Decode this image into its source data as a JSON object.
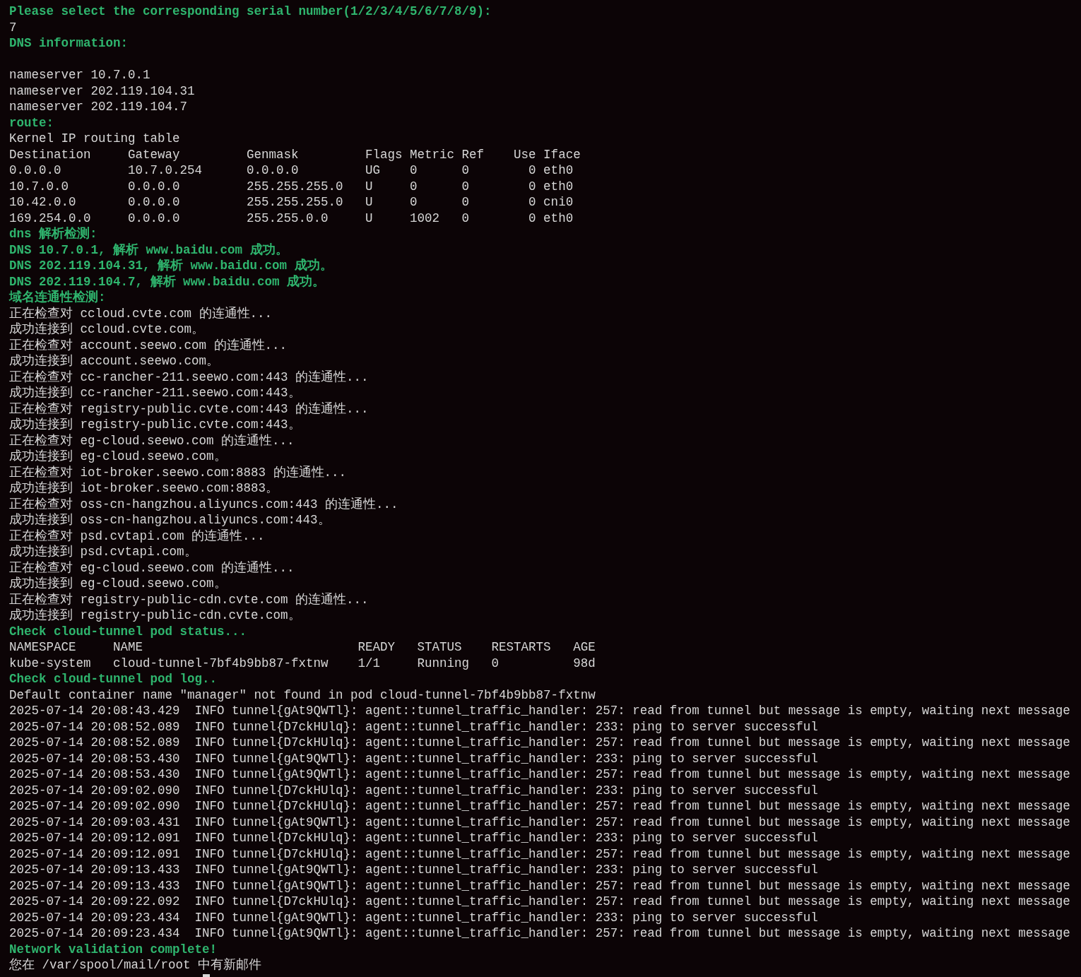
{
  "terminal": {
    "lines": [
      {
        "kind": "heading",
        "text": "Please select the corresponding serial number(1/2/3/4/5/6/7/8/9):"
      },
      {
        "kind": "plain",
        "text": "7"
      },
      {
        "kind": "heading",
        "text": "DNS information:"
      },
      {
        "kind": "blank"
      },
      {
        "kind": "plain",
        "text": "nameserver 10.7.0.1"
      },
      {
        "kind": "plain",
        "text": "nameserver 202.119.104.31"
      },
      {
        "kind": "plain",
        "text": "nameserver 202.119.104.7"
      },
      {
        "kind": "heading",
        "text": "route:"
      },
      {
        "kind": "plain",
        "text": "Kernel IP routing table"
      },
      {
        "kind": "plain",
        "text": "Destination     Gateway         Genmask         Flags Metric Ref    Use Iface"
      },
      {
        "kind": "plain",
        "text": "0.0.0.0         10.7.0.254      0.0.0.0         UG    0      0        0 eth0"
      },
      {
        "kind": "plain",
        "text": "10.7.0.0        0.0.0.0         255.255.255.0   U     0      0        0 eth0"
      },
      {
        "kind": "plain",
        "text": "10.42.0.0       0.0.0.0         255.255.255.0   U     0      0        0 cni0"
      },
      {
        "kind": "plain",
        "text": "169.254.0.0     0.0.0.0         255.255.0.0     U     1002   0        0 eth0"
      },
      {
        "kind": "heading",
        "text": "dns 解析检测:"
      },
      {
        "kind": "heading",
        "text": "DNS 10.7.0.1, 解析 www.baidu.com 成功。"
      },
      {
        "kind": "heading",
        "text": "DNS 202.119.104.31, 解析 www.baidu.com 成功。"
      },
      {
        "kind": "heading",
        "text": "DNS 202.119.104.7, 解析 www.baidu.com 成功。"
      },
      {
        "kind": "heading",
        "text": "域名连通性检测:"
      },
      {
        "kind": "plain",
        "text": "正在检查对 ccloud.cvte.com 的连通性..."
      },
      {
        "kind": "plain",
        "text": "成功连接到 ccloud.cvte.com。"
      },
      {
        "kind": "plain",
        "text": "正在检查对 account.seewo.com 的连通性..."
      },
      {
        "kind": "plain",
        "text": "成功连接到 account.seewo.com。"
      },
      {
        "kind": "plain",
        "text": "正在检查对 cc-rancher-211.seewo.com:443 的连通性..."
      },
      {
        "kind": "plain",
        "text": "成功连接到 cc-rancher-211.seewo.com:443。"
      },
      {
        "kind": "plain",
        "text": "正在检查对 registry-public.cvte.com:443 的连通性..."
      },
      {
        "kind": "plain",
        "text": "成功连接到 registry-public.cvte.com:443。"
      },
      {
        "kind": "plain",
        "text": "正在检查对 eg-cloud.seewo.com 的连通性..."
      },
      {
        "kind": "plain",
        "text": "成功连接到 eg-cloud.seewo.com。"
      },
      {
        "kind": "plain",
        "text": "正在检查对 iot-broker.seewo.com:8883 的连通性..."
      },
      {
        "kind": "plain",
        "text": "成功连接到 iot-broker.seewo.com:8883。"
      },
      {
        "kind": "plain",
        "text": "正在检查对 oss-cn-hangzhou.aliyuncs.com:443 的连通性..."
      },
      {
        "kind": "plain",
        "text": "成功连接到 oss-cn-hangzhou.aliyuncs.com:443。"
      },
      {
        "kind": "plain",
        "text": "正在检查对 psd.cvtapi.com 的连通性..."
      },
      {
        "kind": "plain",
        "text": "成功连接到 psd.cvtapi.com。"
      },
      {
        "kind": "plain",
        "text": "正在检查对 eg-cloud.seewo.com 的连通性..."
      },
      {
        "kind": "plain",
        "text": "成功连接到 eg-cloud.seewo.com。"
      },
      {
        "kind": "plain",
        "text": "正在检查对 registry-public-cdn.cvte.com 的连通性..."
      },
      {
        "kind": "plain",
        "text": "成功连接到 registry-public-cdn.cvte.com。"
      },
      {
        "kind": "heading",
        "text": "Check cloud-tunnel pod status..."
      },
      {
        "kind": "plain",
        "text": "NAMESPACE     NAME                             READY   STATUS    RESTARTS   AGE"
      },
      {
        "kind": "plain",
        "text": "kube-system   cloud-tunnel-7bf4b9bb87-fxtnw    1/1     Running   0          98d"
      },
      {
        "kind": "heading",
        "text": "Check cloud-tunnel pod log.."
      },
      {
        "kind": "plain",
        "text": "Default container name \"manager\" not found in pod cloud-tunnel-7bf4b9bb87-fxtnw"
      },
      {
        "kind": "plain",
        "text": "2025-07-14 20:08:43.429  INFO tunnel{gAt9QWTl}: agent::tunnel_traffic_handler: 257: read from tunnel but message is empty, waiting next message"
      },
      {
        "kind": "plain",
        "text": "2025-07-14 20:08:52.089  INFO tunnel{D7ckHUlq}: agent::tunnel_traffic_handler: 233: ping to server successful"
      },
      {
        "kind": "plain",
        "text": "2025-07-14 20:08:52.089  INFO tunnel{D7ckHUlq}: agent::tunnel_traffic_handler: 257: read from tunnel but message is empty, waiting next message"
      },
      {
        "kind": "plain",
        "text": "2025-07-14 20:08:53.430  INFO tunnel{gAt9QWTl}: agent::tunnel_traffic_handler: 233: ping to server successful"
      },
      {
        "kind": "plain",
        "text": "2025-07-14 20:08:53.430  INFO tunnel{gAt9QWTl}: agent::tunnel_traffic_handler: 257: read from tunnel but message is empty, waiting next message"
      },
      {
        "kind": "plain",
        "text": "2025-07-14 20:09:02.090  INFO tunnel{D7ckHUlq}: agent::tunnel_traffic_handler: 233: ping to server successful"
      },
      {
        "kind": "plain",
        "text": "2025-07-14 20:09:02.090  INFO tunnel{D7ckHUlq}: agent::tunnel_traffic_handler: 257: read from tunnel but message is empty, waiting next message"
      },
      {
        "kind": "plain",
        "text": "2025-07-14 20:09:03.431  INFO tunnel{gAt9QWTl}: agent::tunnel_traffic_handler: 257: read from tunnel but message is empty, waiting next message"
      },
      {
        "kind": "plain",
        "text": "2025-07-14 20:09:12.091  INFO tunnel{D7ckHUlq}: agent::tunnel_traffic_handler: 233: ping to server successful"
      },
      {
        "kind": "plain",
        "text": "2025-07-14 20:09:12.091  INFO tunnel{D7ckHUlq}: agent::tunnel_traffic_handler: 257: read from tunnel but message is empty, waiting next message"
      },
      {
        "kind": "plain",
        "text": "2025-07-14 20:09:13.433  INFO tunnel{gAt9QWTl}: agent::tunnel_traffic_handler: 233: ping to server successful"
      },
      {
        "kind": "plain",
        "text": "2025-07-14 20:09:13.433  INFO tunnel{gAt9QWTl}: agent::tunnel_traffic_handler: 257: read from tunnel but message is empty, waiting next message"
      },
      {
        "kind": "plain",
        "text": "2025-07-14 20:09:22.092  INFO tunnel{D7ckHUlq}: agent::tunnel_traffic_handler: 257: read from tunnel but message is empty, waiting next message"
      },
      {
        "kind": "plain",
        "text": "2025-07-14 20:09:23.434  INFO tunnel{gAt9QWTl}: agent::tunnel_traffic_handler: 233: ping to server successful"
      },
      {
        "kind": "plain",
        "text": "2025-07-14 20:09:23.434  INFO tunnel{gAt9QWTl}: agent::tunnel_traffic_handler: 257: read from tunnel but message is empty, waiting next message"
      },
      {
        "kind": "heading",
        "text": "Network validation complete!"
      },
      {
        "kind": "plain",
        "text": "您在 /var/spool/mail/root 中有新邮件"
      },
      {
        "kind": "cursor"
      }
    ]
  }
}
